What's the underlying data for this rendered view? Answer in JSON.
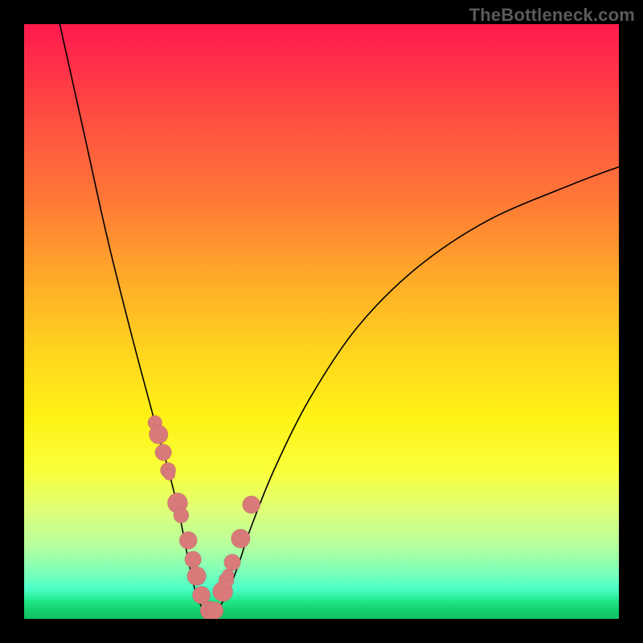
{
  "watermark": "TheBottleneck.com",
  "chart_data": {
    "type": "line",
    "title": "",
    "xlabel": "",
    "ylabel": "",
    "xlim": [
      0,
      100
    ],
    "ylim": [
      0,
      100
    ],
    "grid": false,
    "legend": false,
    "background_gradient": {
      "stops": [
        {
          "pos": 0,
          "desc": "red"
        },
        {
          "pos": 50,
          "desc": "yellow"
        },
        {
          "pos": 100,
          "desc": "green"
        }
      ]
    },
    "series": [
      {
        "name": "bottleneck-curve",
        "x": [
          6,
          10,
          14,
          18,
          22,
          24,
          26,
          27,
          28,
          29,
          30.5,
          32,
          34,
          36,
          38,
          42,
          48,
          56,
          66,
          78,
          92,
          100
        ],
        "y": [
          100,
          82,
          64,
          48,
          33,
          26,
          18,
          13,
          8,
          4,
          1,
          1,
          4,
          9,
          15,
          25,
          37,
          49,
          59,
          67,
          73,
          76
        ]
      }
    ],
    "highlight_dots": {
      "x": [
        22.0,
        22.6,
        23.4,
        24.2,
        24.4,
        25.8,
        26.4,
        27.6,
        28.4,
        29.0,
        29.8,
        31.2,
        32.0,
        33.4,
        34.0,
        34.3,
        35.0,
        36.4,
        38.2
      ],
      "y": [
        33.0,
        31.0,
        28.0,
        25.0,
        24.3,
        19.5,
        17.4,
        13.2,
        10.0,
        7.2,
        4.0,
        1.4,
        1.4,
        4.6,
        6.5,
        7.4,
        9.5,
        13.5,
        19.2
      ],
      "r": [
        1.2,
        1.6,
        1.4,
        1.3,
        1.0,
        1.7,
        1.3,
        1.5,
        1.4,
        1.6,
        1.5,
        1.6,
        1.5,
        1.7,
        1.3,
        1.0,
        1.4,
        1.6,
        1.5
      ]
    }
  }
}
